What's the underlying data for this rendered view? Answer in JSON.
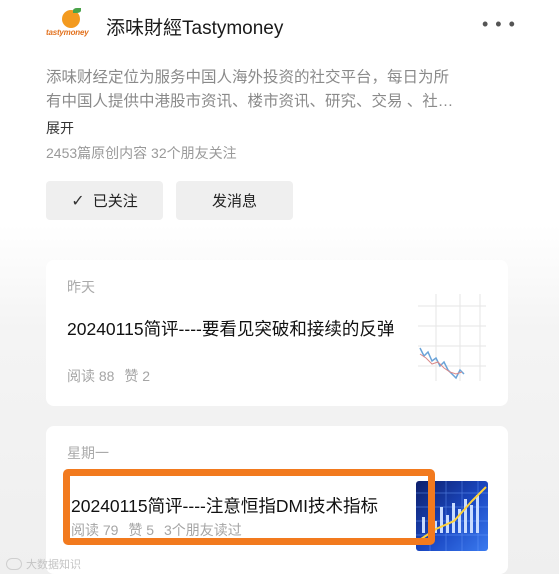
{
  "account": {
    "logo_text": "tastymoney",
    "name": "添味財經Tastymoney",
    "description_line1": "添味财经定位为服务中国人海外投资的社交平台，每日为所",
    "description_line2": "有中国人提供中港股市资讯、楼市资讯、研究、交易 、社…",
    "expand_label": "展开",
    "stats_text": "2453篇原创内容  32个朋友关注"
  },
  "actions": {
    "follow_label": "已关注",
    "message_label": "发消息"
  },
  "articles": [
    {
      "date": "昨天",
      "title": "20240115简评----要看见突破和接续的反弹",
      "reads": "阅读 88",
      "likes": "赞 2"
    },
    {
      "date": "星期一",
      "title": "20240115简评----注意恒指DMI技术指标",
      "reads": "阅读 79",
      "likes": "赞 5",
      "friends": "3个朋友读过"
    }
  ],
  "watermark": "大数据知识",
  "colors": {
    "highlight": "#f27a1e",
    "logo_orange": "#f39a1f",
    "thumb_blue": "#1b49c4"
  }
}
